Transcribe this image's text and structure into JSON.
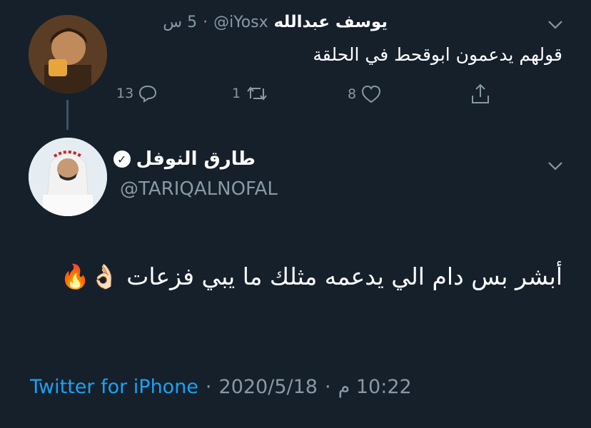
{
  "reply_tweet": {
    "author_name": "يوسف عبدالله",
    "handle": "@iYosx",
    "separator": "·",
    "time": "5 س",
    "text": "قولهم يدعمون ابوقحط في الحلقة",
    "reply_count": "13",
    "retweet_count": "1",
    "like_count": "8",
    "icons": {
      "more": "chevron-down-icon",
      "reply": "reply-icon",
      "retweet": "retweet-icon",
      "like": "heart-icon",
      "share": "share-icon"
    }
  },
  "main_tweet": {
    "author_name": "طارق النوفل",
    "handle": "@TARIQALNOFAL",
    "verified": true,
    "text": "أبشر بس دام الي يدعمه مثلك ما يبي فزعات 👌🏻🔥",
    "source": "Twitter for iPhone",
    "separator": "·",
    "date": "2020/5/18",
    "time": "10:22 م"
  },
  "colors": {
    "background": "#15202b",
    "text": "#ffffff",
    "muted": "#8899a6",
    "link": "#1da1f2",
    "thread_line": "#3d5466"
  }
}
